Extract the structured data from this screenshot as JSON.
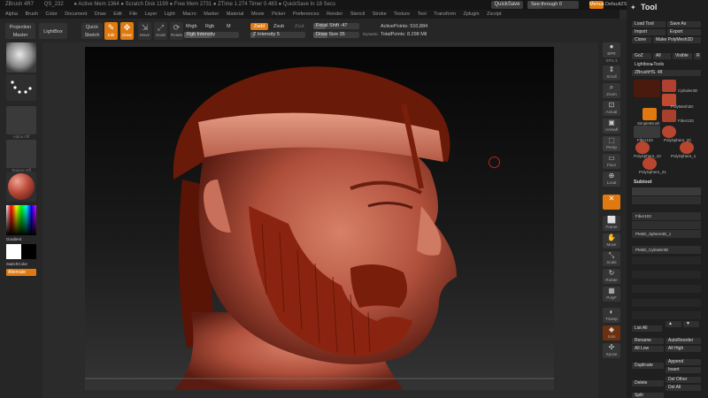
{
  "titlebar": {
    "items": [
      "ZBrush 4R7",
      "QS_232",
      "● Active Mem 1364 ● Scratch Disk 1199 ● Free Mem 2731 ● ZTime 1.274 Timer 0.483 ● QuickSave In 18 Secs"
    ],
    "quicksave": "QuickSave",
    "see_through": "See-through 0",
    "menus": "Menus",
    "script": "DefaultZScript"
  },
  "menubar": {
    "items": [
      "Alpha",
      "Brush",
      "Color",
      "Document",
      "Draw",
      "Edit",
      "File",
      "Layer",
      "Light",
      "Macro",
      "Marker",
      "Material",
      "Movie",
      "Picker",
      "Preferences",
      "Render",
      "Stencil",
      "Stroke",
      "Texture",
      "Tool",
      "Transform",
      "Zplugin",
      "Zscript"
    ]
  },
  "toolbar": {
    "projection_master": "Projection Master",
    "lightbox": "LightBox",
    "quick_sketch": "Quick Sketch",
    "edit": "Edit",
    "draw": "Draw",
    "move": "Move",
    "scale": "Scale",
    "rotate": "Rotate",
    "mrgb": "Mrgb",
    "rgb": "Rgb",
    "m": "M",
    "rgb_intensity": "Rgb Intensity",
    "zadd": "Zadd",
    "zsub": "Zsub",
    "zcut": "Zcut",
    "z_intensity": "Z Intensity 5",
    "focal_shift": "Focal Shift -47",
    "draw_size": "Draw Size 35",
    "dynamic": "Dynamic",
    "active_points": "ActivePoints: 510,884",
    "total_points": "TotalPoints: 8.298 Mil"
  },
  "left_shelf": {
    "labels": [
      "",
      "",
      "Alpha Off",
      "Texture Off",
      ""
    ],
    "gradient": "Gradient",
    "switch_color": "SwitchColor",
    "alternate": "Alternate"
  },
  "right_shelf": {
    "buttons": [
      "BPR",
      "SPix 3",
      "Scroll",
      "Zoom",
      "Actual",
      "AAHalf",
      "Persp",
      "Floor",
      "Local",
      "Frame",
      "Move",
      "Scale",
      "Rotate",
      "PolyF",
      "Transp",
      "Solo",
      "Xpose"
    ]
  },
  "tool_palette": {
    "title": "Tool",
    "load_tool": "Load Tool",
    "save_as": "Save As",
    "import": "Import",
    "export": "Export",
    "clone": "Clone",
    "make_polymesh": "Make PolyMesh3D",
    "goz": "GoZ",
    "all": "All",
    "visible": "Visible",
    "r": "R",
    "lightbox_tools": "Lightbox▸Tools",
    "current_tool": "ZBrushHS. 48",
    "tools": [
      "Cylinder3D",
      "PolyMesh3D",
      "SimpleBrush",
      "Fiber103",
      "Fiber103",
      "PolySphere_20",
      "PolySphere_10",
      "PolySphere_1",
      "PolySphere_21"
    ],
    "subtool": "Subtool",
    "subtools": [
      "",
      "",
      "Fiber103",
      "",
      "PM3D_Sphere3D_1",
      "PM3D_Cylinder3D",
      "",
      "",
      "",
      "",
      ""
    ],
    "list_all": "List All",
    "rename": "Rename",
    "autoreorder": "AutoReorder",
    "all_low": "All Low",
    "all_high": "All High",
    "duplicate": "Duplicate",
    "append": "Append",
    "insert": "Insert",
    "delete": "Delete",
    "del_other": "Del Other",
    "del_all": "Del All",
    "split": "Split"
  },
  "colors": {
    "accent": "#e07a10",
    "material": "#b94a3a",
    "hair": "#8a2410"
  }
}
